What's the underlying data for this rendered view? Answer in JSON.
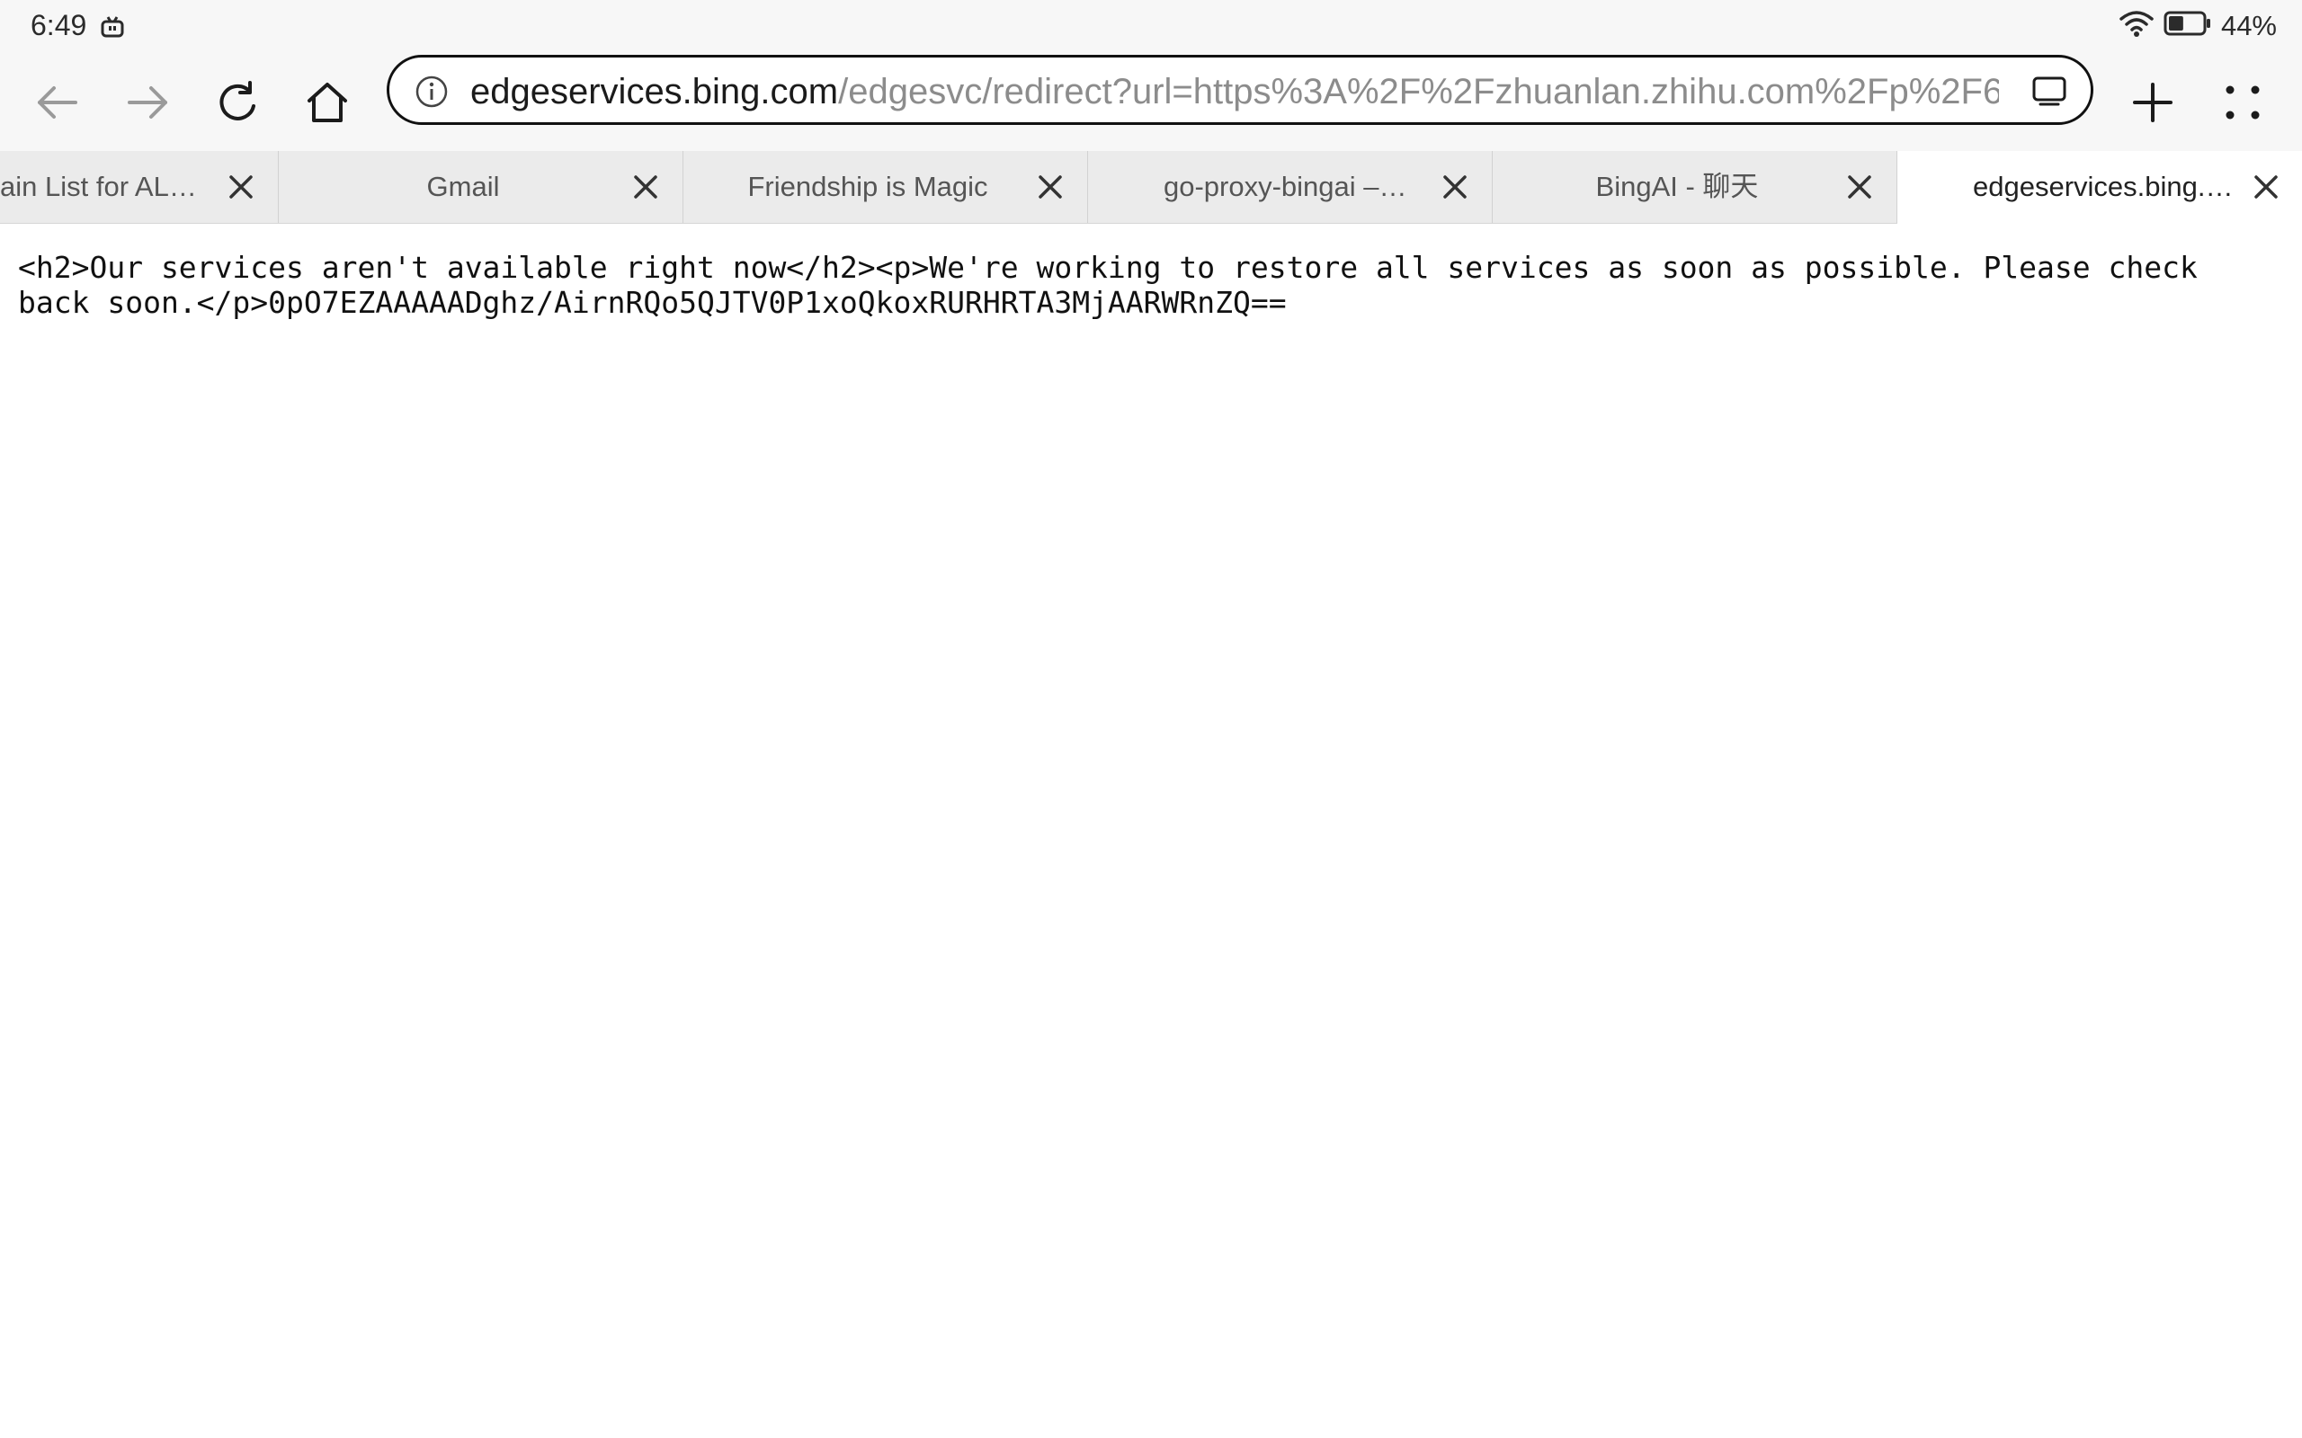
{
  "status_bar": {
    "time": "6:49",
    "battery_percent": "44%",
    "battery_level": 0.44,
    "icons": [
      "tv-icon",
      "wifi-icon",
      "battery-icon"
    ]
  },
  "toolbar": {
    "buttons": [
      "back-icon",
      "forward-icon",
      "reload-icon",
      "home-icon",
      "add-tab-icon",
      "menu-dots-icon"
    ],
    "url_host": "edgeservices.bing.com",
    "url_path": "/edgesvc/redirect?url=https%3A%2F%2Fzhuanlan.zhihu.com%2Fp%2F6"
  },
  "tabs": [
    {
      "title": "ain List for AL…",
      "active": false
    },
    {
      "title": "Gmail",
      "active": false
    },
    {
      "title": "Friendship is Magic",
      "active": false
    },
    {
      "title": "go-proxy-bingai –…",
      "active": false
    },
    {
      "title": "BingAI - 聊天",
      "active": false
    },
    {
      "title": "edgeservices.bing.…",
      "active": true
    }
  ],
  "page": {
    "body_text": "<h2>Our services aren't available right now</h2><p>We're working to restore all services as soon as possible. Please check back soon.</p>0pO7EZAAAAADghz/AirnRQo5QJTV0P1xoQkoxRURHRTA3MjAARWRnZQ=="
  },
  "colors": {
    "chrome_bg": "#f7f7f7",
    "tabstrip_bg": "#ebebeb",
    "active_tab_bg": "#ffffff",
    "url_path_gray": "#8c8c8c"
  }
}
